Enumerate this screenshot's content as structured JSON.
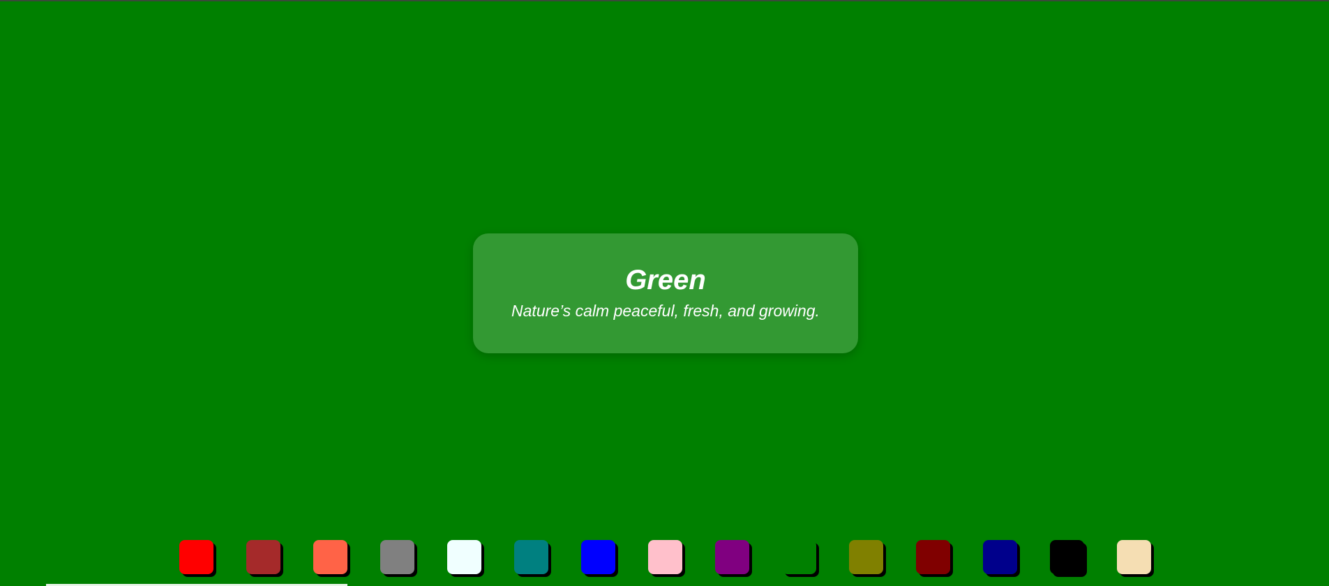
{
  "page": {
    "background_color": "#008000"
  },
  "card": {
    "title": "Green",
    "description": "Nature’s calm peaceful, fresh, and growing."
  },
  "swatches": [
    {
      "color": "#ff0000"
    },
    {
      "color": "#a52a2a"
    },
    {
      "color": "#ff6347"
    },
    {
      "color": "#808080"
    },
    {
      "color": "#f0ffff"
    },
    {
      "color": "#008080"
    },
    {
      "color": "#0000ff"
    },
    {
      "color": "#ffc0cb"
    },
    {
      "color": "#800080"
    },
    {
      "color": "#008000"
    },
    {
      "color": "#808000"
    },
    {
      "color": "#800000"
    },
    {
      "color": "#00008b"
    },
    {
      "color": "#000000"
    },
    {
      "color": "#f5deb3"
    }
  ]
}
